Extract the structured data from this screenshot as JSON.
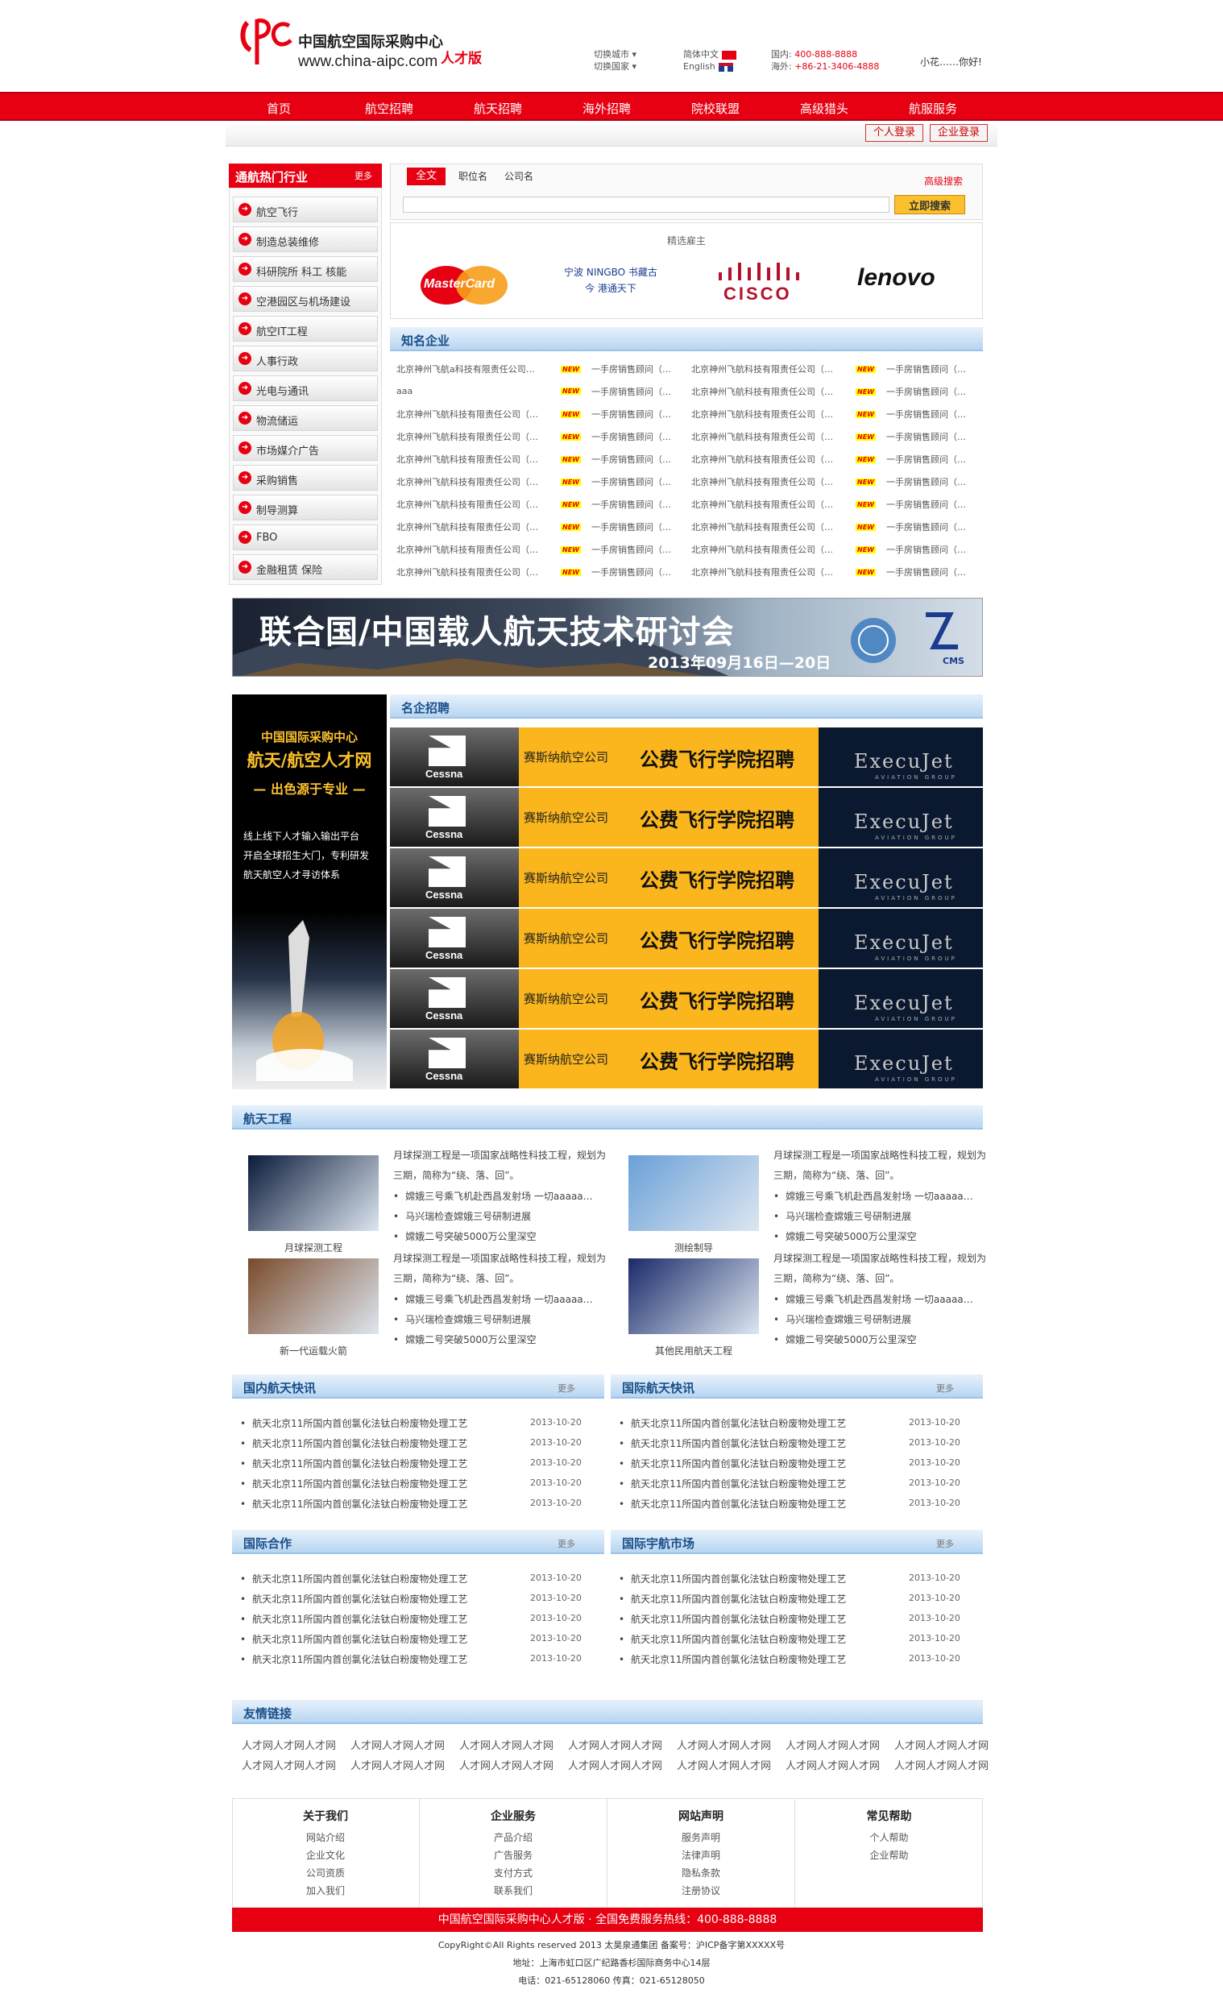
{
  "header": {
    "logo_cn": "中国航空国际采购中心",
    "logo_url": "www.china-aipc.com",
    "logo_edition": "人才版",
    "city_switch": "切换城市",
    "country_switch": "切换国家",
    "lang_cn": "简体中文",
    "lang_en": "English",
    "tel_domestic_label": "国内:",
    "tel_domestic": "400-888-8888",
    "tel_overseas_label": "海外:",
    "tel_overseas": "+86-21-3406-4888",
    "user_greeting": "小花……你好!"
  },
  "nav": [
    "首页",
    "航空招聘",
    "航天招聘",
    "海外招聘",
    "院校联盟",
    "高级猎头",
    "航服服务"
  ],
  "login": {
    "personal": "个人登录",
    "company": "企业登录"
  },
  "sidebar": {
    "title": "通航热门行业",
    "more": "更多",
    "items": [
      "航空飞行",
      "制造总装维修",
      "科研院所 科工 核能",
      "空港园区与机场建设",
      "航空IT工程",
      "人事行政",
      "光电与通讯",
      "物流储运",
      "市场媒介广告",
      "采购销售",
      "制导测算",
      "FBO",
      "金融租赁 保险"
    ]
  },
  "search": {
    "tabs": [
      "全文",
      "职位名",
      "公司名"
    ],
    "advanced": "高级搜索",
    "placeholder": "",
    "button": "立即搜索"
  },
  "employers": {
    "title": "精选雇主",
    "items": [
      "MasterCard",
      "宁波 NINGBO 书藏古今 港通天下",
      "CISCO",
      "lenovo"
    ]
  },
  "companies": {
    "title": "知名企业",
    "company_name": "北京神州飞航科技有限责任公司（…",
    "company_name_alt": "北京神州飞航a科技有限责任公司…",
    "short_name": "aaa",
    "badge": "NEW",
    "job": "一手房销售顾问（…"
  },
  "banner": {
    "title": "联合国/中国载人航天技术研讨会",
    "date": "2013年09月16日—20日",
    "cms": "CMS"
  },
  "rocket_ad": {
    "line1": "中国国际采购中心",
    "line2": "航天/航空人才网",
    "line3": "— 出色源于专业 —",
    "copy1": "线上线下人才输入输出平台",
    "copy2": "开启全球招生大门，专利研发",
    "copy3": "航天航空人才寻访体系"
  },
  "famous_jobs": {
    "title": "名企招聘",
    "brand": "Cessna",
    "company": "赛斯纳航空公司",
    "headline": "公费飞行学院招聘",
    "partner": "ExecuJet",
    "partner_sub": "AVIATION GROUP"
  },
  "space_eng": {
    "title": "航天工程",
    "intro": "月球探测工程是一项国家战略性科技工程，规划为三期，简称为“绕、落、回”。",
    "bullets": [
      "嫦娥三号乘飞机赴西昌发射场 一切aaaaa…",
      "马兴瑞检查嫦娥三号研制进展",
      "嫦娥二号突破5000万公里深空"
    ],
    "captions": [
      "月球探测工程",
      "测绘制导",
      "新一代运载火箭",
      "其他民用航天工程"
    ]
  },
  "news": {
    "more": "更多",
    "item": "航天北京11所国内首创氯化法钛白粉废物处理工艺",
    "date": "2013-10-20",
    "sections": [
      "国内航天快讯",
      "国际航天快讯",
      "国际合作",
      "国际宇航市场"
    ]
  },
  "links": {
    "title": "友情链接",
    "item": "人才网人才网人才网"
  },
  "footer": {
    "cols": [
      {
        "title": "关于我们",
        "items": [
          "网站介绍",
          "企业文化",
          "公司资质",
          "加入我们"
        ]
      },
      {
        "title": "企业服务",
        "items": [
          "产品介绍",
          "广告服务",
          "支付方式",
          "联系我们"
        ]
      },
      {
        "title": "网站声明",
        "items": [
          "服务声明",
          "法律声明",
          "隐私条款",
          "注册协议"
        ]
      },
      {
        "title": "常见帮助",
        "items": [
          "个人帮助",
          "企业帮助"
        ]
      }
    ],
    "bar": "中国航空国际采购中心人才版 · 全国免费服务热线：400-888-8888",
    "copyright": "CopyRight©All Rights reserved 2013 太昊泉通集团 备案号：沪ICP备字第XXXXX号",
    "address": "地址：上海市虹口区广纪路香杉国际商务中心14层",
    "phone": "电话：021-65128060 传真：021-65128050"
  },
  "colors": {
    "brand_red": "#e60012",
    "section_blue": "#1a4f8a",
    "ad_yellow": "#fab61c"
  }
}
